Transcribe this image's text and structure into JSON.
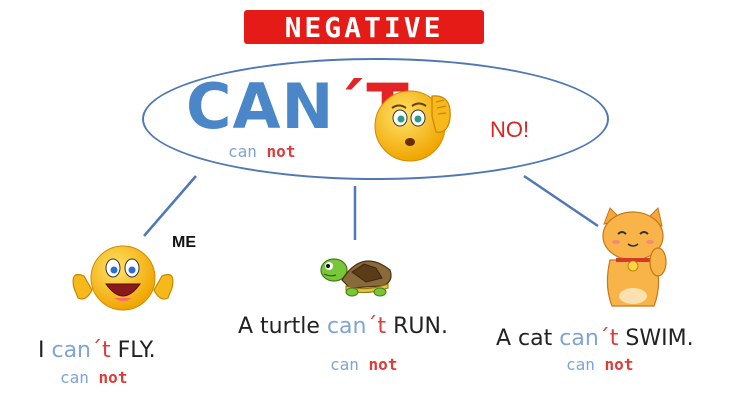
{
  "title": "NEGATIVE",
  "main": {
    "contraction_base": "CAN",
    "contraction_apostrophe": "´",
    "contraction_tail": "T",
    "split_can": "can",
    "split_not": "not",
    "exclamation": "NO!"
  },
  "examples": [
    {
      "label": "ME",
      "prefix": "I ",
      "can": "can",
      "apostrophe": "´",
      "t": "t",
      "suffix": " FLY.",
      "split_can": "can",
      "split_not": "not",
      "icon": "laughing-emoji-icon"
    },
    {
      "prefix": "A turtle ",
      "can": "can",
      "apostrophe": "´",
      "t": "t",
      "suffix": " RUN.",
      "split_can": "can",
      "split_not": "not",
      "icon": "turtle-icon"
    },
    {
      "prefix": "A cat ",
      "can": "can",
      "apostrophe": "´",
      "t": "t",
      "suffix": " SWIM.",
      "split_can": "can",
      "split_not": "not",
      "icon": "lucky-cat-icon"
    }
  ],
  "colors": {
    "title_bg": "#e41b17",
    "blue": "#4a86c8",
    "red": "#e42424",
    "line": "#4f78b4"
  }
}
